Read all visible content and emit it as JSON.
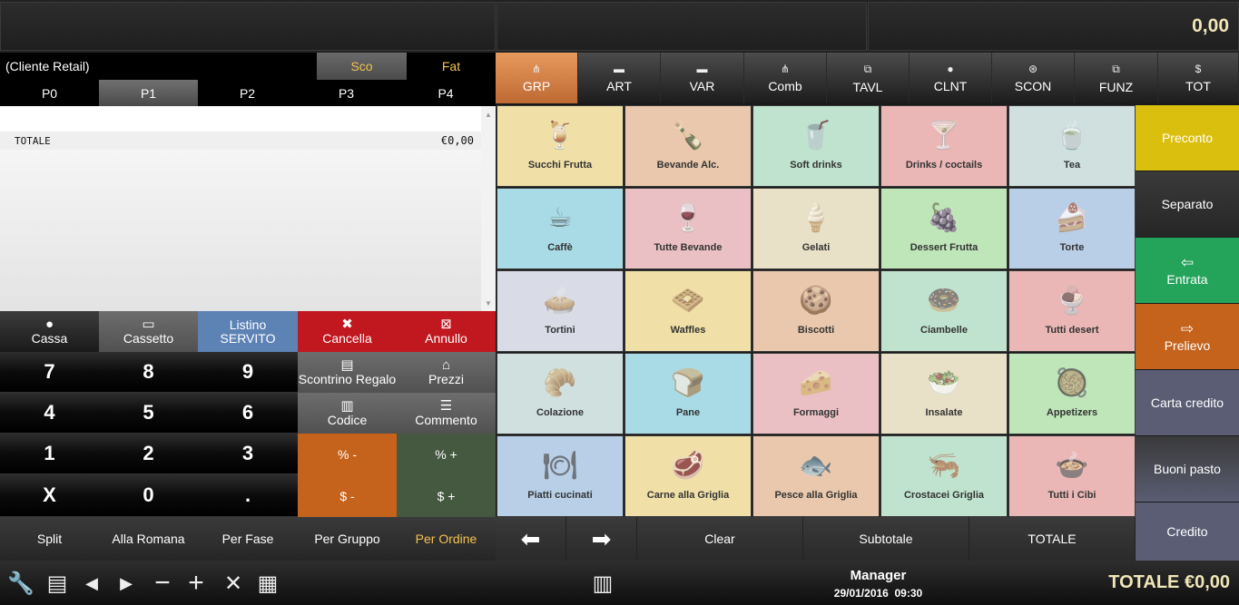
{
  "display": {
    "total": "0,00"
  },
  "customer": {
    "name": "(Cliente Retail)",
    "sco": "Sco",
    "fat": "Fat"
  },
  "price_tabs": [
    "P0",
    "P1",
    "P2",
    "P3",
    "P4"
  ],
  "receipt": {
    "total_label": "TOTALE",
    "total_value": "€0,00"
  },
  "functions": {
    "cassa": "Cassa",
    "cassetto": "Cassetto",
    "listino_line1": "Listino",
    "listino_line2": "SERVITO",
    "cancella": "Cancella",
    "annullo": "Annullo",
    "scontrino_regalo": "Scontrino Regalo",
    "prezzi": "Prezzi",
    "codice": "Codice",
    "commento": "Commento",
    "perc_minus": "% -",
    "perc_plus": "% +",
    "val_minus": "$ -",
    "val_plus": "$ +"
  },
  "keypad": [
    "7",
    "8",
    "9",
    "4",
    "5",
    "6",
    "1",
    "2",
    "3",
    "X",
    "0",
    "."
  ],
  "modes": [
    "Split",
    "Alla Romana",
    "Per Fase",
    "Per Gruppo",
    "Per Ordine"
  ],
  "category_tabs": [
    {
      "label": "GRP",
      "icon": "group-icon"
    },
    {
      "label": "ART",
      "icon": "article-icon"
    },
    {
      "label": "VAR",
      "icon": "variant-icon"
    },
    {
      "label": "Comb",
      "icon": "combo-icon"
    },
    {
      "label": "TAVL",
      "icon": "table-icon"
    },
    {
      "label": "CLNT",
      "icon": "client-icon"
    },
    {
      "label": "SCON",
      "icon": "discount-icon"
    },
    {
      "label": "FUNZ",
      "icon": "function-icon"
    },
    {
      "label": "TOT",
      "icon": "total-icon"
    }
  ],
  "tiles": [
    {
      "label": "Succhi Frutta",
      "icon": "juice-icon",
      "color": "#f0e0a8"
    },
    {
      "label": "Bevande Alc.",
      "icon": "bottle-icon",
      "color": "#e9c8ad"
    },
    {
      "label": "Soft drinks",
      "icon": "soft-drink-icon",
      "color": "#bfe3cf"
    },
    {
      "label": "Drinks / coctails",
      "icon": "cocktail-icon",
      "color": "#eab7b6"
    },
    {
      "label": "Tea",
      "icon": "tea-icon",
      "color": "#cfe0df"
    },
    {
      "label": "Caffè",
      "icon": "coffee-icon",
      "color": "#a8dbe6"
    },
    {
      "label": "Tutte Bevande",
      "icon": "wine-icon",
      "color": "#eac0c5"
    },
    {
      "label": "Gelati",
      "icon": "ice-cream-icon",
      "color": "#e8e1c8"
    },
    {
      "label": "Dessert Frutta",
      "icon": "grapes-icon",
      "color": "#bfe6b9"
    },
    {
      "label": "Torte",
      "icon": "cake-icon",
      "color": "#b9cfe8"
    },
    {
      "label": "Tortini",
      "icon": "pie-icon",
      "color": "#d9dce7"
    },
    {
      "label": "Waffles",
      "icon": "waffle-icon",
      "color": "#f0e0a8"
    },
    {
      "label": "Biscotti",
      "icon": "biscuit-icon",
      "color": "#e9c8ad"
    },
    {
      "label": "Ciambelle",
      "icon": "donut-icon",
      "color": "#bfe3cf"
    },
    {
      "label": "Tutti desert",
      "icon": "sundae-icon",
      "color": "#eab7b6"
    },
    {
      "label": "Colazione",
      "icon": "breakfast-icon",
      "color": "#cfe0df"
    },
    {
      "label": "Pane",
      "icon": "bread-icon",
      "color": "#a8dbe6"
    },
    {
      "label": "Formaggi",
      "icon": "cheese-icon",
      "color": "#eac0c5"
    },
    {
      "label": "Insalate",
      "icon": "salad-icon",
      "color": "#e8e1c8"
    },
    {
      "label": "Appetizers",
      "icon": "appetizer-icon",
      "color": "#bfe6b9"
    },
    {
      "label": "Piatti cucinati",
      "icon": "cloche-icon",
      "color": "#b9cfe8"
    },
    {
      "label": "Carne alla Griglia",
      "icon": "steak-icon",
      "color": "#f0e0a8"
    },
    {
      "label": "Pesce alla Griglia",
      "icon": "fish-icon",
      "color": "#e9c8ad"
    },
    {
      "label": "Crostacei Griglia",
      "icon": "shrimp-icon",
      "color": "#bfe3cf"
    },
    {
      "label": "Tutti i Cibi",
      "icon": "dish-icon",
      "color": "#eab7b6"
    }
  ],
  "right_buttons": {
    "preconto": "Preconto",
    "separato": "Separato",
    "entrata": "Entrata",
    "prelievo": "Prelievo",
    "carta_credito": "Carta credito",
    "buoni_pasto": "Buoni pasto",
    "credito": "Credito"
  },
  "nav": {
    "clear": "Clear",
    "subtotale": "Subtotale",
    "totale": "TOTALE"
  },
  "status": {
    "user": "Manager",
    "datetime": "29/01/2016  09:30",
    "total": "TOTALE €0,00"
  },
  "colors": {
    "accent_orange": "#c5631c",
    "active_tab": "#d9824a",
    "red": "#c1171e",
    "blue": "#5d83b5",
    "green": "#23a45a",
    "yellow": "#dbbf0e",
    "display_text": "#f0e6b8"
  }
}
